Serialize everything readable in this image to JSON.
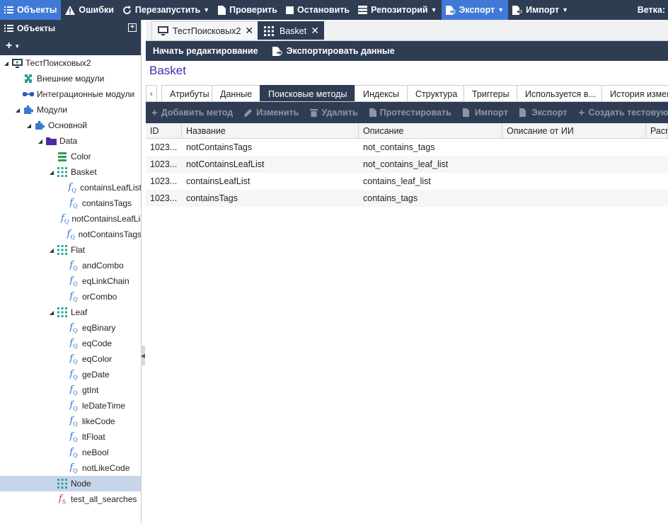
{
  "topbar": {
    "objects": "Объекты",
    "errors": "Ошибки",
    "restart": "Перезапустить",
    "check": "Проверить",
    "stop": "Остановить",
    "repository": "Репозиторий",
    "export": "Экспорт",
    "import": "Импорт",
    "branch": "Ветка:"
  },
  "left": {
    "title": "Объекты",
    "tree": [
      {
        "label": "ТестПоисковых2",
        "depth": 0,
        "tog": "▲",
        "icon": "project"
      },
      {
        "label": "Внешние модули",
        "depth": 1,
        "tog": "",
        "icon": "ext"
      },
      {
        "label": "Интеграционные модули",
        "depth": 1,
        "tog": "",
        "icon": "integ"
      },
      {
        "label": "Модули",
        "depth": 1,
        "tog": "▲",
        "icon": "puzzle"
      },
      {
        "label": "Основной",
        "depth": 2,
        "tog": "▲",
        "icon": "puzzle"
      },
      {
        "label": "Data",
        "depth": 3,
        "tog": "▲",
        "icon": "folder"
      },
      {
        "label": "Color",
        "depth": 4,
        "tog": "",
        "icon": "enum"
      },
      {
        "label": "Basket",
        "depth": 4,
        "tog": "▲",
        "icon": "grid"
      },
      {
        "label": "containsLeafList",
        "depth": 5,
        "tog": "",
        "icon": "fq"
      },
      {
        "label": "containsTags",
        "depth": 5,
        "tog": "",
        "icon": "fq"
      },
      {
        "label": "notContainsLeafList",
        "depth": 5,
        "tog": "",
        "icon": "fq"
      },
      {
        "label": "notContainsTags",
        "depth": 5,
        "tog": "",
        "icon": "fq"
      },
      {
        "label": "Flat",
        "depth": 4,
        "tog": "▲",
        "icon": "grid"
      },
      {
        "label": "andCombo",
        "depth": 5,
        "tog": "",
        "icon": "fq"
      },
      {
        "label": "eqLinkChain",
        "depth": 5,
        "tog": "",
        "icon": "fq"
      },
      {
        "label": "orCombo",
        "depth": 5,
        "tog": "",
        "icon": "fq"
      },
      {
        "label": "Leaf",
        "depth": 4,
        "tog": "▲",
        "icon": "grid"
      },
      {
        "label": "eqBinary",
        "depth": 5,
        "tog": "",
        "icon": "fq"
      },
      {
        "label": "eqCode",
        "depth": 5,
        "tog": "",
        "icon": "fq"
      },
      {
        "label": "eqColor",
        "depth": 5,
        "tog": "",
        "icon": "fq"
      },
      {
        "label": "geDate",
        "depth": 5,
        "tog": "",
        "icon": "fq"
      },
      {
        "label": "gtInt",
        "depth": 5,
        "tog": "",
        "icon": "fq"
      },
      {
        "label": "leDateTime",
        "depth": 5,
        "tog": "",
        "icon": "fq"
      },
      {
        "label": "likeCode",
        "depth": 5,
        "tog": "",
        "icon": "fq"
      },
      {
        "label": "ltFloat",
        "depth": 5,
        "tog": "",
        "icon": "fq"
      },
      {
        "label": "neBool",
        "depth": 5,
        "tog": "",
        "icon": "fq"
      },
      {
        "label": "notLikeCode",
        "depth": 5,
        "tog": "",
        "icon": "fq"
      },
      {
        "label": "Node",
        "depth": 4,
        "tog": "",
        "icon": "grid",
        "selected": true
      },
      {
        "label": "test_all_searches",
        "depth": 4,
        "tog": "",
        "icon": "fs"
      }
    ]
  },
  "doctabs": [
    {
      "label": "ТестПоисковых2",
      "active": false
    },
    {
      "label": "Basket",
      "active": true
    }
  ],
  "actions": {
    "edit": "Начать редактирование",
    "export_data": "Экспортировать данные"
  },
  "page_title": "Basket",
  "subtabs": [
    {
      "label": "Атрибуты",
      "active": false
    },
    {
      "label": "Данные",
      "active": false
    },
    {
      "label": "Поисковые методы",
      "active": true
    },
    {
      "label": "Индексы",
      "active": false
    },
    {
      "label": "Структура",
      "active": false
    },
    {
      "label": "Триггеры",
      "active": false
    },
    {
      "label": "Используется в...",
      "active": false
    },
    {
      "label": "История измен",
      "active": false
    }
  ],
  "gridtools": {
    "add": "Добавить метод",
    "edit": "Изменить",
    "delete": "Удалить",
    "test": "Протестировать",
    "import": "Импорт",
    "export": "Экспорт",
    "create_test": "Создать тестовую фун"
  },
  "grid": {
    "columns": [
      "ID",
      "Название",
      "Описание",
      "Описание от ИИ",
      "Расп"
    ],
    "rows": [
      [
        "1023...",
        "notContainsTags",
        "not_contains_tags",
        "",
        ""
      ],
      [
        "1023...",
        "notContainsLeafList",
        "not_contains_leaf_list",
        "",
        ""
      ],
      [
        "1023...",
        "containsLeafList",
        "contains_leaf_list",
        "",
        ""
      ],
      [
        "1023...",
        "containsTags",
        "contains_tags",
        "",
        ""
      ]
    ]
  }
}
